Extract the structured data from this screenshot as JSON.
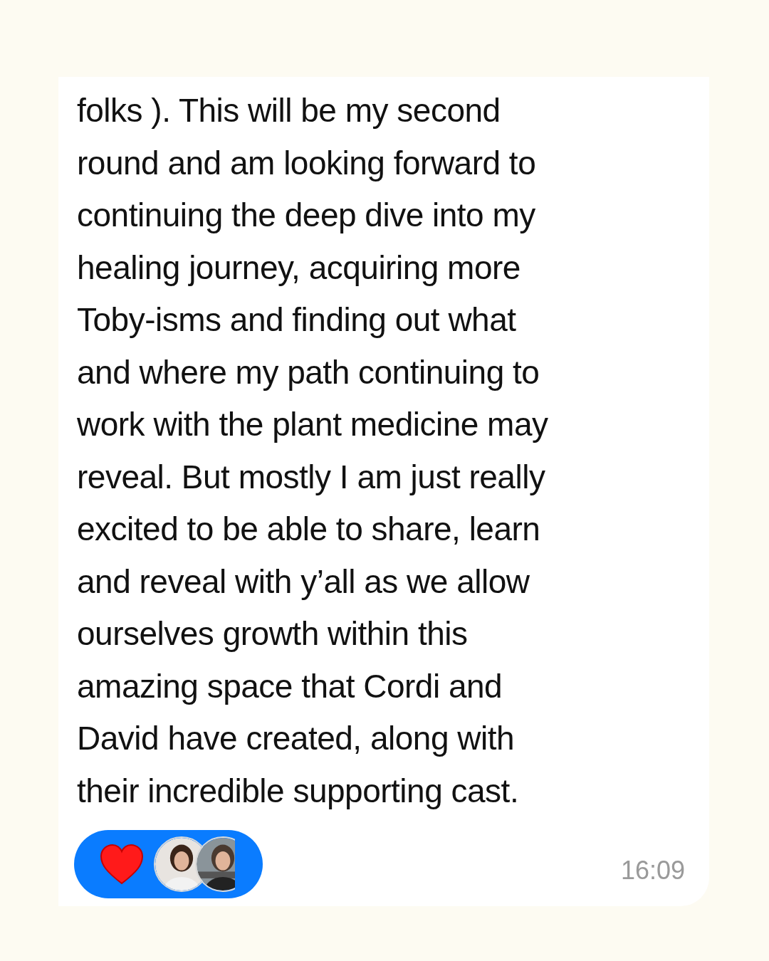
{
  "message": {
    "lines": [
      "folks ). This will be my second",
      "round and am looking forward to",
      "continuing the deep dive into my",
      "healing journey, acquiring more",
      "Toby-isms and finding out what",
      "and where my path continuing to",
      "work with the plant medicine may",
      "reveal. But mostly I am just really",
      "excited to be able to share, learn",
      "and reveal with y’all as we allow",
      "ourselves growth within this",
      "amazing space that Cordi and",
      "David have created, along with",
      "their incredible supporting cast."
    ],
    "time": "16:09"
  }
}
